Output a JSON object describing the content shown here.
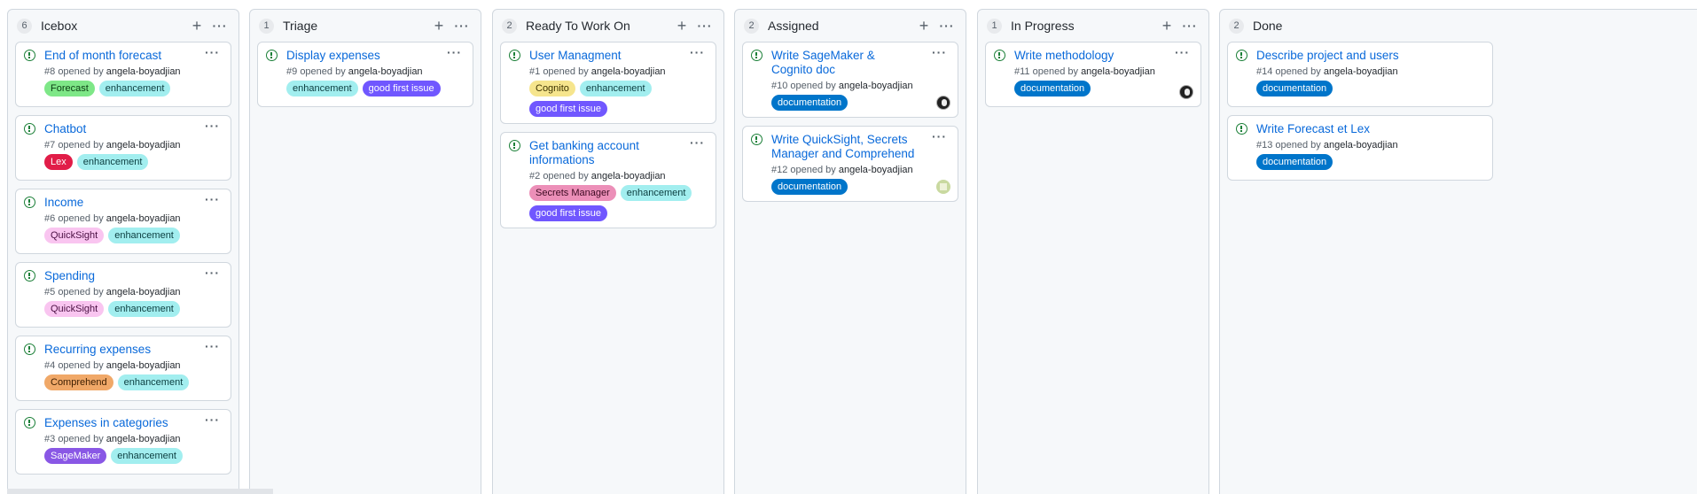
{
  "colors": {
    "Forecast": {
      "bg": "#7ee787",
      "fg": "#0b3d12"
    },
    "enhancement": {
      "bg": "#a2eeef",
      "fg": "#0b3d3f"
    },
    "Lex": {
      "bg": "#e11d48",
      "fg": "#ffffff"
    },
    "QuickSight": {
      "bg": "#f9c5f0",
      "fg": "#4b1043"
    },
    "Comprehend": {
      "bg": "#f0a868",
      "fg": "#3b1d00"
    },
    "SageMaker": {
      "bg": "#8957e5",
      "fg": "#ffffff"
    },
    "good first issue": {
      "bg": "#7057ff",
      "fg": "#ffffff"
    },
    "Cognito": {
      "bg": "#f6e58d",
      "fg": "#3d3300"
    },
    "Secrets Manager": {
      "bg": "#ec8fb8",
      "fg": "#3d0a22"
    },
    "documentation": {
      "bg": "#0075ca",
      "fg": "#ffffff"
    }
  },
  "columns": [
    {
      "title": "Icebox",
      "count": "6",
      "cards": [
        {
          "title": "End of month forecast",
          "num": "#8",
          "labels": [
            "Forecast",
            "enhancement"
          ],
          "avatar": ""
        },
        {
          "title": "Chatbot",
          "num": "#7",
          "labels": [
            "Lex",
            "enhancement"
          ],
          "avatar": ""
        },
        {
          "title": "Income",
          "num": "#6",
          "labels": [
            "QuickSight",
            "enhancement"
          ],
          "avatar": ""
        },
        {
          "title": "Spending",
          "num": "#5",
          "labels": [
            "QuickSight",
            "enhancement"
          ],
          "avatar": ""
        },
        {
          "title": "Recurring expenses",
          "num": "#4",
          "labels": [
            "Comprehend",
            "enhancement"
          ],
          "avatar": ""
        },
        {
          "title": "Expenses in categories",
          "num": "#3",
          "labels": [
            "SageMaker",
            "enhancement"
          ],
          "avatar": ""
        }
      ]
    },
    {
      "title": "Triage",
      "count": "1",
      "cards": [
        {
          "title": "Display expenses",
          "num": "#9",
          "labels": [
            "enhancement",
            "good first issue"
          ],
          "avatar": ""
        }
      ]
    },
    {
      "title": "Ready To Work On",
      "count": "2",
      "cards": [
        {
          "title": "User Managment",
          "num": "#1",
          "labels": [
            "Cognito",
            "enhancement",
            "good first issue"
          ],
          "avatar": ""
        },
        {
          "title": "Get banking account informations",
          "num": "#2",
          "labels": [
            "Secrets Manager",
            "enhancement",
            "good first issue"
          ],
          "avatar": ""
        }
      ]
    },
    {
      "title": "Assigned",
      "count": "2",
      "cards": [
        {
          "title": "Write SageMaker & Cognito doc",
          "num": "#10",
          "labels": [
            "documentation"
          ],
          "avatar": "dark"
        },
        {
          "title": "Write QuickSight, Secrets Manager and Comprehend",
          "num": "#12",
          "labels": [
            "documentation"
          ],
          "avatar": "green"
        }
      ]
    },
    {
      "title": "In Progress",
      "count": "1",
      "cards": [
        {
          "title": "Write methodology",
          "num": "#11",
          "labels": [
            "documentation"
          ],
          "avatar": "dark"
        }
      ]
    },
    {
      "title": "Done",
      "count": "2",
      "cards": [
        {
          "title": "Describe project and users",
          "num": "#14",
          "labels": [
            "documentation"
          ],
          "avatar": ""
        },
        {
          "title": "Write Forecast et Lex",
          "num": "#13",
          "labels": [
            "documentation"
          ],
          "avatar": ""
        }
      ]
    }
  ],
  "opened_by_text": "opened by",
  "author": "angela-boyadjian",
  "add_icon": "plus-icon",
  "more_icon": "kebab-menu-icon"
}
